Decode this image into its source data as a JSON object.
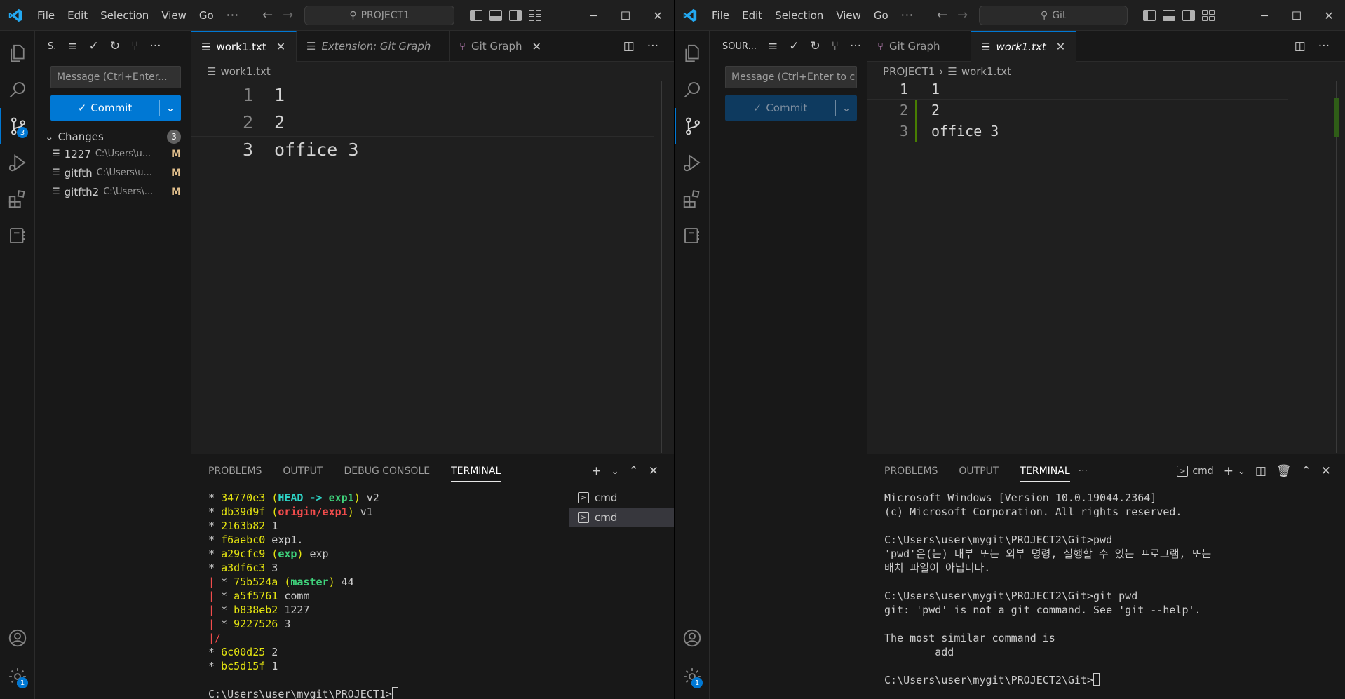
{
  "left": {
    "menu": [
      "File",
      "Edit",
      "Selection",
      "View",
      "Go"
    ],
    "more": "···",
    "search": "PROJECT1",
    "badges": {
      "scm": "3",
      "settings": "1"
    },
    "sidebar": {
      "title": "S.",
      "message_placeholder": "Message (Ctrl+Enter...",
      "commit_label": "Commit",
      "changes_label": "Changes",
      "changes_count": "3",
      "changes": [
        {
          "name": "1227",
          "path": "C:\\Users\\u...",
          "status": "M"
        },
        {
          "name": "gitfth",
          "path": "C:\\Users\\u...",
          "status": "M"
        },
        {
          "name": "gitfth2",
          "path": "C:\\Users\\...",
          "status": "M"
        }
      ]
    },
    "tabs": [
      {
        "label": "work1.txt"
      },
      {
        "label": "Extension: Git Graph"
      },
      {
        "label": "Git Graph"
      }
    ],
    "breadcrumb": "work1.txt",
    "lines": [
      {
        "n": "1",
        "t": "1"
      },
      {
        "n": "2",
        "t": "2"
      },
      {
        "n": "3",
        "t": "office 3"
      }
    ],
    "panel_tabs": [
      "PROBLEMS",
      "OUTPUT",
      "DEBUG CONSOLE",
      "TERMINAL"
    ],
    "terminal_list": [
      "cmd",
      "cmd"
    ],
    "prompt": "C:\\Users\\user\\mygit\\PROJECT1>"
  },
  "right": {
    "menu": [
      "File",
      "Edit",
      "Selection",
      "View",
      "Go"
    ],
    "more": "···",
    "search": "Git",
    "badges": {
      "settings": "1"
    },
    "sidebar": {
      "title": "SOUR...",
      "message_placeholder": "Message (Ctrl+Enter to co...",
      "commit_label": "Commit"
    },
    "tabs": [
      {
        "label": "Git Graph"
      },
      {
        "label": "work1.txt"
      }
    ],
    "breadcrumb": [
      "PROJECT1",
      "work1.txt"
    ],
    "lines": [
      {
        "n": "1",
        "t": "1"
      },
      {
        "n": "2",
        "t": "2"
      },
      {
        "n": "3",
        "t": "office 3"
      }
    ],
    "panel_tabs": [
      "PROBLEMS",
      "OUTPUT",
      "TERMINAL"
    ],
    "panel_more": "···",
    "terminal_name": "cmd",
    "terminal_lines": [
      "Microsoft Windows [Version 10.0.19044.2364]",
      "(c) Microsoft Corporation. All rights reserved.",
      "",
      "C:\\Users\\user\\mygit\\PROJECT2\\Git>pwd",
      "'pwd'은(는) 내부 또는 외부 명령, 실행할 수 있는 프로그램, 또는",
      "배치 파일이 아닙니다.",
      "",
      "C:\\Users\\user\\mygit\\PROJECT2\\Git>git pwd",
      "git: 'pwd' is not a git command. See 'git --help'.",
      "",
      "The most similar command is",
      "        add",
      ""
    ],
    "prompt": "C:\\Users\\user\\mygit\\PROJECT2\\Git>"
  },
  "git_log": [
    {
      "graph": "* ",
      "hash": "34770e3",
      "refs": [
        {
          "t": "(",
          "c": "y"
        },
        {
          "t": "HEAD -> ",
          "c": "c"
        },
        {
          "t": "exp1",
          "c": "g"
        },
        {
          "t": ")",
          "c": "y"
        }
      ],
      "msg": " v2"
    },
    {
      "graph": "* ",
      "hash": "db39d9f",
      "refs": [
        {
          "t": "(",
          "c": "y"
        },
        {
          "t": "origin/exp1",
          "c": "r"
        },
        {
          "t": ")",
          "c": "y"
        }
      ],
      "msg": " v1"
    },
    {
      "graph": "* ",
      "hash": "2163b82",
      "refs": [],
      "msg": " 1"
    },
    {
      "graph": "* ",
      "hash": "f6aebc0",
      "refs": [],
      "msg": " exp1."
    },
    {
      "graph": "* ",
      "hash": "a29cfc9",
      "refs": [
        {
          "t": "(",
          "c": "y"
        },
        {
          "t": "exp",
          "c": "g"
        },
        {
          "t": ")",
          "c": "y"
        }
      ],
      "msg": " exp"
    },
    {
      "graph": "* ",
      "hash": "a3df6c3",
      "refs": [],
      "msg": " 3"
    },
    {
      "graph": "| * ",
      "hash": "75b524a",
      "refs": [
        {
          "t": "(",
          "c": "y"
        },
        {
          "t": "master",
          "c": "g"
        },
        {
          "t": ")",
          "c": "y"
        }
      ],
      "msg": " 44"
    },
    {
      "graph": "| * ",
      "hash": "a5f5761",
      "refs": [],
      "msg": " comm"
    },
    {
      "graph": "| * ",
      "hash": "b838eb2",
      "refs": [],
      "msg": " 1227"
    },
    {
      "graph": "| * ",
      "hash": "9227526",
      "refs": [],
      "msg": " 3"
    },
    {
      "graph": "|/",
      "hash": "",
      "refs": [],
      "msg": ""
    },
    {
      "graph": "* ",
      "hash": "6c00d25",
      "refs": [],
      "msg": " 2"
    },
    {
      "graph": "* ",
      "hash": "bc5d15f",
      "refs": [],
      "msg": " 1"
    }
  ],
  "colors": {
    "accent": "#0078d4",
    "modified": "#e2c08d",
    "hash": "#e5e510",
    "branch": "#3fd27b",
    "remote": "#f14c4c",
    "head": "#2ed6c8"
  }
}
